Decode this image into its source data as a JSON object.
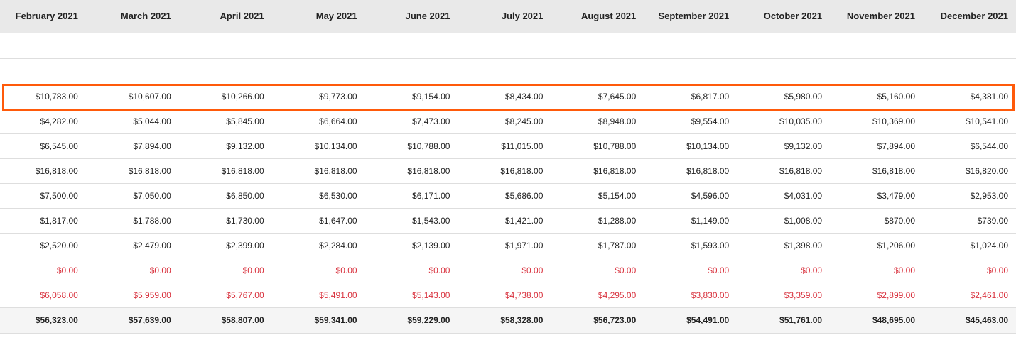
{
  "months": [
    "February 2021",
    "March 2021",
    "April 2021",
    "May 2021",
    "June 2021",
    "July 2021",
    "August 2021",
    "September 2021",
    "October 2021",
    "November 2021",
    "December 2021"
  ],
  "rows": [
    {
      "type": "empty",
      "cells": [
        "",
        "",
        "",
        "",
        "",
        "",
        "",
        "",
        "",
        "",
        ""
      ]
    },
    {
      "type": "empty",
      "cells": [
        "",
        "",
        "",
        "",
        "",
        "",
        "",
        "",
        "",
        "",
        ""
      ]
    },
    {
      "type": "highlight",
      "cells": [
        "$10,783.00",
        "$10,607.00",
        "$10,266.00",
        "$9,773.00",
        "$9,154.00",
        "$8,434.00",
        "$7,645.00",
        "$6,817.00",
        "$5,980.00",
        "$5,160.00",
        "$4,381.00"
      ]
    },
    {
      "type": "normal",
      "cells": [
        "$4,282.00",
        "$5,044.00",
        "$5,845.00",
        "$6,664.00",
        "$7,473.00",
        "$8,245.00",
        "$8,948.00",
        "$9,554.00",
        "$10,035.00",
        "$10,369.00",
        "$10,541.00"
      ]
    },
    {
      "type": "normal",
      "cells": [
        "$6,545.00",
        "$7,894.00",
        "$9,132.00",
        "$10,134.00",
        "$10,788.00",
        "$11,015.00",
        "$10,788.00",
        "$10,134.00",
        "$9,132.00",
        "$7,894.00",
        "$6,544.00"
      ]
    },
    {
      "type": "normal",
      "cells": [
        "$16,818.00",
        "$16,818.00",
        "$16,818.00",
        "$16,818.00",
        "$16,818.00",
        "$16,818.00",
        "$16,818.00",
        "$16,818.00",
        "$16,818.00",
        "$16,818.00",
        "$16,820.00"
      ]
    },
    {
      "type": "normal",
      "cells": [
        "$7,500.00",
        "$7,050.00",
        "$6,850.00",
        "$6,530.00",
        "$6,171.00",
        "$5,686.00",
        "$5,154.00",
        "$4,596.00",
        "$4,031.00",
        "$3,479.00",
        "$2,953.00"
      ]
    },
    {
      "type": "normal",
      "cells": [
        "$1,817.00",
        "$1,788.00",
        "$1,730.00",
        "$1,647.00",
        "$1,543.00",
        "$1,421.00",
        "$1,288.00",
        "$1,149.00",
        "$1,008.00",
        "$870.00",
        "$739.00"
      ]
    },
    {
      "type": "normal",
      "cells": [
        "$2,520.00",
        "$2,479.00",
        "$2,399.00",
        "$2,284.00",
        "$2,139.00",
        "$1,971.00",
        "$1,787.00",
        "$1,593.00",
        "$1,398.00",
        "$1,206.00",
        "$1,024.00"
      ]
    },
    {
      "type": "red",
      "cells": [
        "$0.00",
        "$0.00",
        "$0.00",
        "$0.00",
        "$0.00",
        "$0.00",
        "$0.00",
        "$0.00",
        "$0.00",
        "$0.00",
        "$0.00"
      ]
    },
    {
      "type": "red",
      "cells": [
        "$6,058.00",
        "$5,959.00",
        "$5,767.00",
        "$5,491.00",
        "$5,143.00",
        "$4,738.00",
        "$4,295.00",
        "$3,830.00",
        "$3,359.00",
        "$2,899.00",
        "$2,461.00"
      ]
    },
    {
      "type": "total",
      "cells": [
        "$56,323.00",
        "$57,639.00",
        "$58,807.00",
        "$59,341.00",
        "$59,229.00",
        "$58,328.00",
        "$56,723.00",
        "$54,491.00",
        "$51,761.00",
        "$48,695.00",
        "$45,463.00"
      ]
    }
  ],
  "colors": {
    "header_bg": "#e9e9e9",
    "highlight_border": "#ff5a0a",
    "negative_text": "#d9333f",
    "total_bg": "#f5f5f5"
  }
}
